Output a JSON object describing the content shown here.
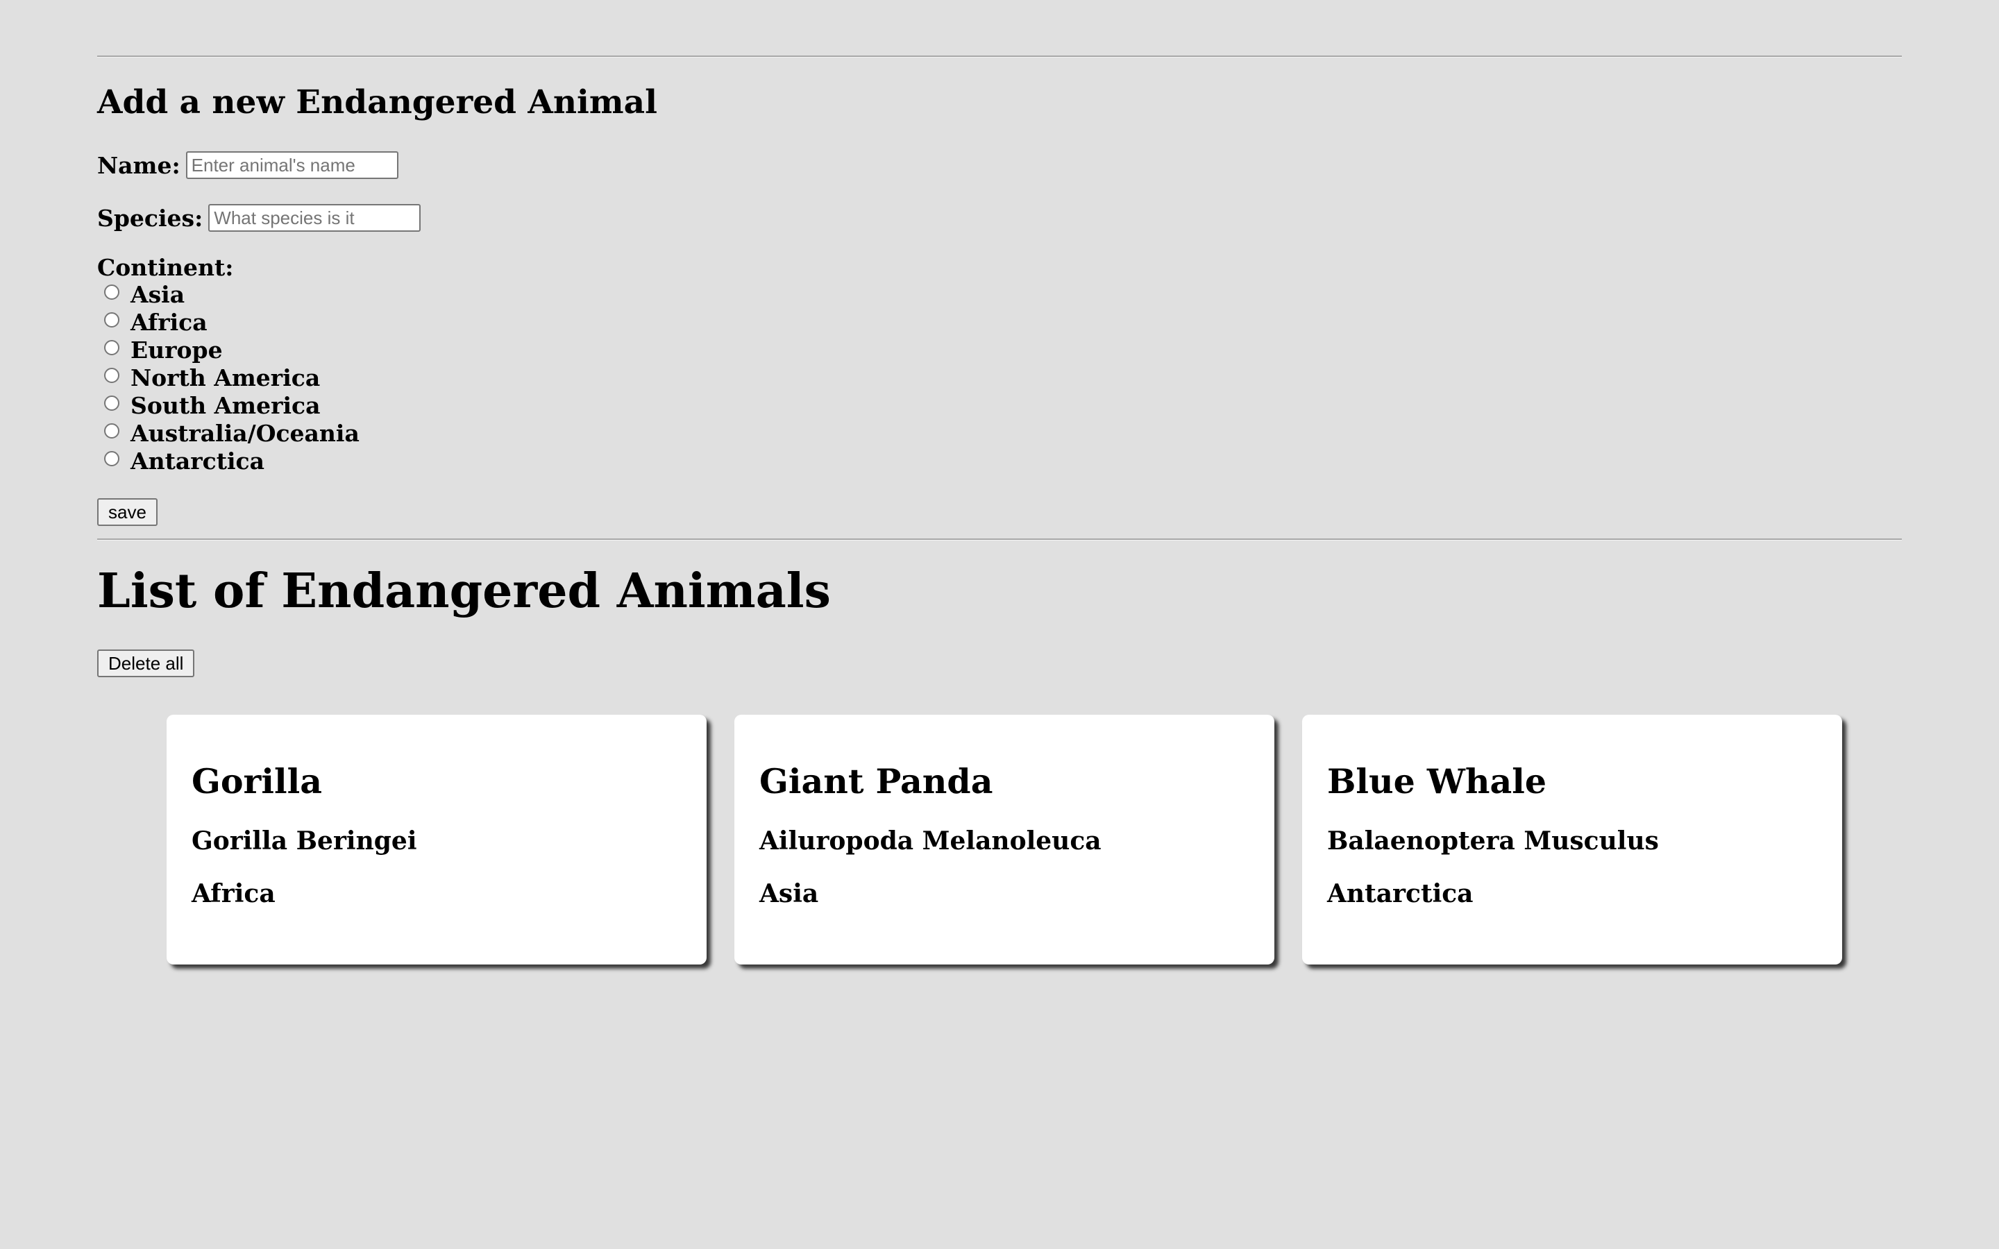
{
  "form": {
    "title": "Add a new Endangered Animal",
    "name_label": "Name:",
    "name_placeholder": "Enter animal's name",
    "species_label": "Species:",
    "species_placeholder": "What species is it",
    "continent_label": "Continent:",
    "continents": [
      "Asia",
      "Africa",
      "Europe",
      "North America",
      "South America",
      "Australia/Oceania",
      "Antarctica"
    ],
    "save_label": "save"
  },
  "list": {
    "title": "List of Endangered Animals",
    "delete_all_label": "Delete all",
    "animals": [
      {
        "name": "Gorilla",
        "species": "Gorilla Beringei",
        "continent": "Africa"
      },
      {
        "name": "Giant Panda",
        "species": "Ailuropoda Melanoleuca",
        "continent": "Asia"
      },
      {
        "name": "Blue Whale",
        "species": "Balaenoptera Musculus",
        "continent": "Antarctica"
      }
    ]
  },
  "colors": {
    "page_background": "#e0e0e0",
    "card_background": "#ffffff"
  }
}
